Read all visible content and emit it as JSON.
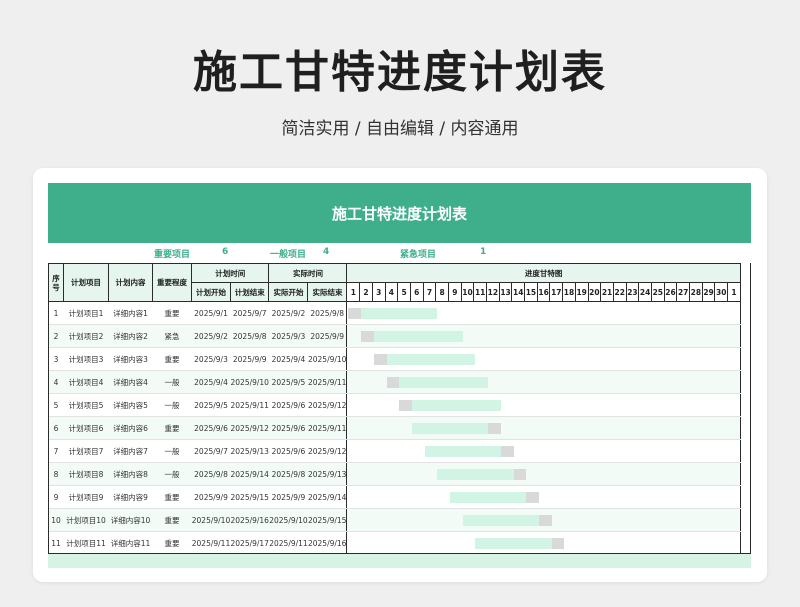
{
  "page": {
    "title": "施工甘特进度计划表",
    "subtitle": "简洁实用 / 自由编辑 / 内容通用"
  },
  "sheet": {
    "banner_title": "施工甘特进度计划表",
    "summary": {
      "important_label": "重要项目",
      "important_count": "6",
      "normal_label": "一般项目",
      "normal_count": "4",
      "urgent_label": "紧急项目",
      "urgent_count": "1"
    },
    "headers": {
      "seq": "序号",
      "item": "计划项目",
      "content": "计划内容",
      "importance": "重要程度",
      "plan_time": "计划时间",
      "actual_time": "实际时间",
      "gantt": "进度甘特图",
      "plan_start": "计划开始",
      "plan_end": "计划结束",
      "actual_start": "实际开始",
      "actual_end": "实际结束"
    },
    "day_labels": [
      "1",
      "2",
      "3",
      "4",
      "5",
      "6",
      "7",
      "8",
      "9",
      "10",
      "11",
      "12",
      "13",
      "14",
      "15",
      "16",
      "17",
      "18",
      "19",
      "20",
      "21",
      "22",
      "23",
      "24",
      "25",
      "26",
      "27",
      "28",
      "29",
      "30",
      "1"
    ],
    "rows": [
      {
        "seq": "1",
        "item": "计划项目1",
        "content": "详细内容1",
        "importance": "重要",
        "plan_start": "2025/9/1",
        "plan_end": "2025/9/7",
        "actual_start": "2025/9/2",
        "actual_end": "2025/9/8",
        "p0": 1,
        "p1": 7,
        "a0": 1,
        "a1": 1
      },
      {
        "seq": "2",
        "item": "计划项目2",
        "content": "详细内容2",
        "importance": "紧急",
        "plan_start": "2025/9/2",
        "plan_end": "2025/9/8",
        "actual_start": "2025/9/3",
        "actual_end": "2025/9/9",
        "p0": 2,
        "p1": 9,
        "a0": 2,
        "a1": 2
      },
      {
        "seq": "3",
        "item": "计划项目3",
        "content": "详细内容3",
        "importance": "重要",
        "plan_start": "2025/9/3",
        "plan_end": "2025/9/9",
        "actual_start": "2025/9/4",
        "actual_end": "2025/9/10",
        "p0": 3,
        "p1": 10,
        "a0": 3,
        "a1": 3
      },
      {
        "seq": "4",
        "item": "计划项目4",
        "content": "详细内容4",
        "importance": "一般",
        "plan_start": "2025/9/4",
        "plan_end": "2025/9/10",
        "actual_start": "2025/9/5",
        "actual_end": "2025/9/11",
        "p0": 4,
        "p1": 11,
        "a0": 4,
        "a1": 4
      },
      {
        "seq": "5",
        "item": "计划项目5",
        "content": "详细内容5",
        "importance": "一般",
        "plan_start": "2025/9/5",
        "plan_end": "2025/9/11",
        "actual_start": "2025/9/6",
        "actual_end": "2025/9/12",
        "p0": 5,
        "p1": 12,
        "a0": 5,
        "a1": 5
      },
      {
        "seq": "6",
        "item": "计划项目6",
        "content": "详细内容6",
        "importance": "重要",
        "plan_start": "2025/9/6",
        "plan_end": "2025/9/12",
        "actual_start": "2025/9/6",
        "actual_end": "2025/9/11",
        "p0": 6,
        "p1": 12,
        "a0": 12,
        "a1": 12
      },
      {
        "seq": "7",
        "item": "计划项目7",
        "content": "详细内容7",
        "importance": "一般",
        "plan_start": "2025/9/7",
        "plan_end": "2025/9/13",
        "actual_start": "2025/9/6",
        "actual_end": "2025/9/12",
        "p0": 7,
        "p1": 13,
        "a0": 13,
        "a1": 13
      },
      {
        "seq": "8",
        "item": "计划项目8",
        "content": "详细内容8",
        "importance": "一般",
        "plan_start": "2025/9/8",
        "plan_end": "2025/9/14",
        "actual_start": "2025/9/8",
        "actual_end": "2025/9/13",
        "p0": 8,
        "p1": 14,
        "a0": 14,
        "a1": 14
      },
      {
        "seq": "9",
        "item": "计划项目9",
        "content": "详细内容9",
        "importance": "重要",
        "plan_start": "2025/9/9",
        "plan_end": "2025/9/15",
        "actual_start": "2025/9/9",
        "actual_end": "2025/9/14",
        "p0": 9,
        "p1": 15,
        "a0": 15,
        "a1": 15
      },
      {
        "seq": "10",
        "item": "计划项目10",
        "content": "详细内容10",
        "importance": "重要",
        "plan_start": "2025/9/10",
        "plan_end": "2025/9/16",
        "actual_start": "2025/9/10",
        "actual_end": "2025/9/15",
        "p0": 10,
        "p1": 16,
        "a0": 16,
        "a1": 16
      },
      {
        "seq": "11",
        "item": "计划项目11",
        "content": "详细内容11",
        "importance": "重要",
        "plan_start": "2025/9/11",
        "plan_end": "2025/9/17",
        "actual_start": "2025/9/11",
        "actual_end": "2025/9/16",
        "p0": 11,
        "p1": 17,
        "a0": 17,
        "a1": 17
      }
    ]
  }
}
